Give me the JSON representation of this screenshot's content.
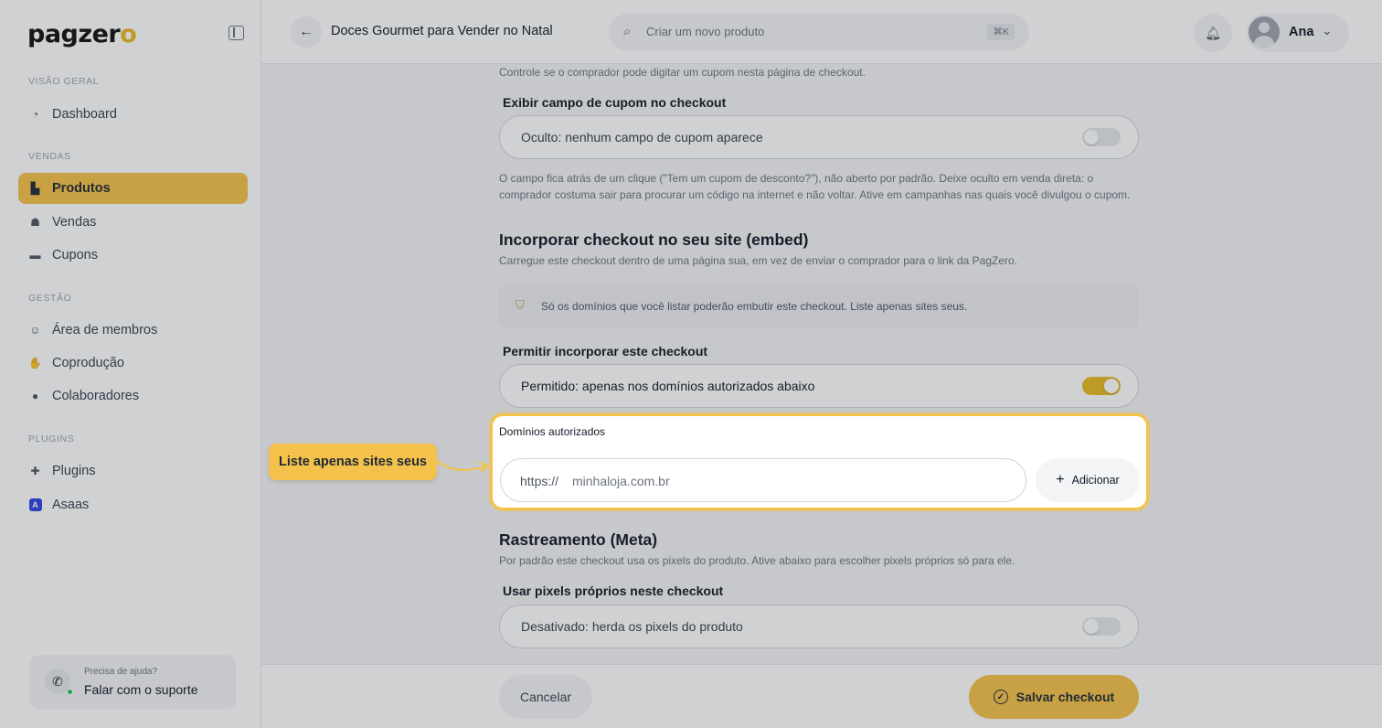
{
  "brand": {
    "logo_main": "pagzer",
    "logo_accent": "o",
    "accent_color": "#f4c24a"
  },
  "sidebar": {
    "sections": [
      {
        "title": "VISÃO GERAL"
      },
      {
        "title": "VENDAS"
      },
      {
        "title": "GESTÃO"
      },
      {
        "title": "PLUGINS"
      }
    ],
    "items": [
      {
        "label": "Dashboard",
        "icon": "dashboard-icon"
      },
      {
        "label": "Produtos",
        "icon": "products-icon",
        "active": true
      },
      {
        "label": "Vendas",
        "icon": "sales-icon"
      },
      {
        "label": "Cupons",
        "icon": "coupon-icon"
      },
      {
        "label": "Área de membros",
        "icon": "members-icon"
      },
      {
        "label": "Coprodução",
        "icon": "handshake-icon"
      },
      {
        "label": "Colaboradores",
        "icon": "collaborators-icon"
      },
      {
        "label": "Plugins",
        "icon": "puzzle-icon"
      },
      {
        "label": "Asaas",
        "icon": "asaas-icon"
      }
    ],
    "help": {
      "small": "Precisa de ajuda?",
      "big": "Falar com o suporte"
    }
  },
  "header": {
    "title": "Doces Gourmet para Vender no Natal",
    "search_placeholder": "Criar um novo produto",
    "shortcut": "⌘K",
    "user_name": "Ana"
  },
  "main": {
    "coupon": {
      "intro": "Controle se o comprador pode digitar um cupom nesta página de checkout.",
      "label": "Exibir campo de cupom no checkout",
      "toggle_text": "Oculto: nenhum campo de cupom aparece",
      "toggle_on": false,
      "help_line1": "O campo fica atrás de um clique (\"Tem um cupom de desconto?\"), não aberto por padrão. Deixe oculto em venda direta: o",
      "help_line2": "comprador costuma sair para procurar um código na internet e não voltar. Ative em campanhas nas quais você divulgou o cupom."
    },
    "embed": {
      "heading": "Incorporar checkout no seu site (embed)",
      "desc": "Carregue este checkout dentro de uma página sua, em vez de enviar o comprador para o link da PagZero.",
      "notice": "Só os domínios que você listar poderão embutir este checkout. Liste apenas sites seus.",
      "label": "Permitir incorporar este checkout",
      "toggle_text": "Permitido: apenas nos domínios autorizados abaixo",
      "toggle_on": true,
      "domains_label": "Domínios autorizados",
      "url_prefix": "https://",
      "url_placeholder": "minhaloja.com.br",
      "add_label": "Adicionar"
    },
    "tracking": {
      "heading": "Rastreamento (Meta)",
      "desc": "Por padrão este checkout usa os pixels do produto. Ative abaixo para escolher pixels próprios só para ele.",
      "label": "Usar pixels próprios neste checkout",
      "toggle_text": "Desativado: herda os pixels do produto",
      "toggle_on": false
    }
  },
  "callout": {
    "text": "Liste apenas sites seus"
  },
  "footer": {
    "cancel": "Cancelar",
    "save": "Salvar checkout"
  }
}
